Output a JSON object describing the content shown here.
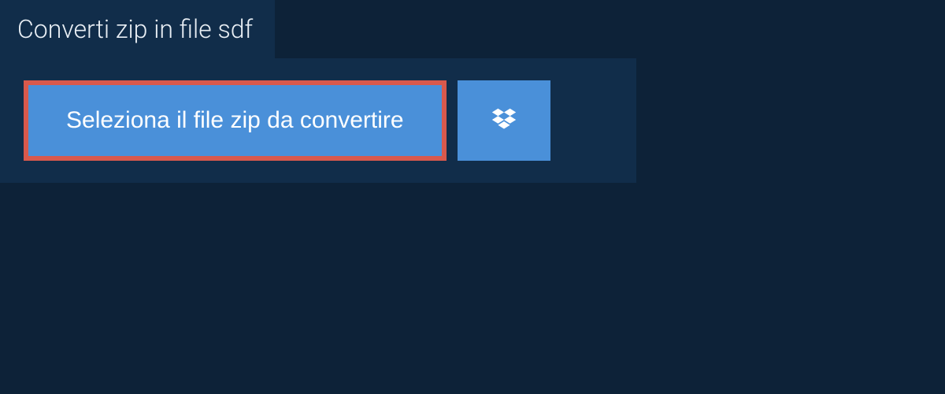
{
  "tab": {
    "title": "Converti zip in file sdf"
  },
  "controls": {
    "select_file_label": "Seleziona il file zip da convertire"
  }
}
